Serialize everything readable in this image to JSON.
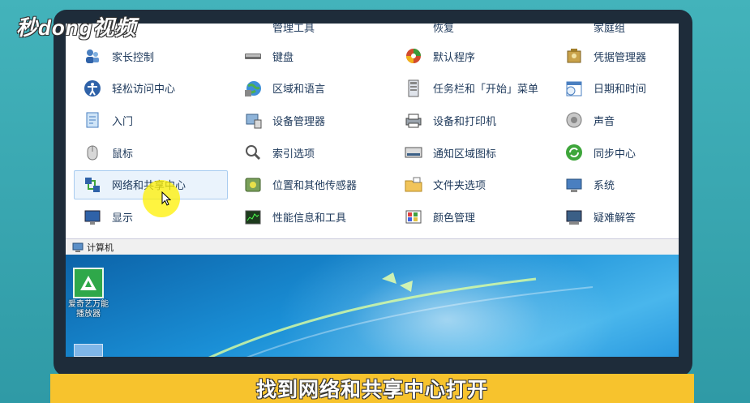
{
  "watermark": "秒dong视频",
  "control_panel": {
    "partial_top_row": [
      "…",
      "管理工具",
      "恢复",
      "家庭组"
    ],
    "items": [
      {
        "label": "家长控制",
        "icon": "parental-controls-icon"
      },
      {
        "label": "键盘",
        "icon": "keyboard-icon"
      },
      {
        "label": "默认程序",
        "icon": "default-programs-icon"
      },
      {
        "label": "凭据管理器",
        "icon": "credential-manager-icon"
      },
      {
        "label": "轻松访问中心",
        "icon": "ease-of-access-icon"
      },
      {
        "label": "区域和语言",
        "icon": "region-language-icon"
      },
      {
        "label": "任务栏和「开始」菜单",
        "icon": "taskbar-start-menu-icon"
      },
      {
        "label": "日期和时间",
        "icon": "date-time-icon"
      },
      {
        "label": "入门",
        "icon": "getting-started-icon"
      },
      {
        "label": "设备管理器",
        "icon": "device-manager-icon"
      },
      {
        "label": "设备和打印机",
        "icon": "devices-printers-icon"
      },
      {
        "label": "声音",
        "icon": "sound-icon"
      },
      {
        "label": "鼠标",
        "icon": "mouse-icon"
      },
      {
        "label": "索引选项",
        "icon": "indexing-options-icon"
      },
      {
        "label": "通知区域图标",
        "icon": "notification-area-icon"
      },
      {
        "label": "同步中心",
        "icon": "sync-center-icon"
      },
      {
        "label": "网络和共享中心",
        "icon": "network-sharing-icon"
      },
      {
        "label": "位置和其他传感器",
        "icon": "location-sensors-icon"
      },
      {
        "label": "文件夹选项",
        "icon": "folder-options-icon"
      },
      {
        "label": "系统",
        "icon": "system-icon"
      },
      {
        "label": "显示",
        "icon": "display-icon"
      },
      {
        "label": "性能信息和工具",
        "icon": "performance-icon"
      },
      {
        "label": "颜色管理",
        "icon": "color-management-icon"
      },
      {
        "label": "疑难解答",
        "icon": "troubleshooting-icon"
      }
    ],
    "status_bar": "计算机"
  },
  "desktop": {
    "icon_label": "爱奇艺万能播放器"
  },
  "subtitle": "找到网络和共享中心打开",
  "colors": {
    "frame": "#3aa6b0",
    "subtitle_bg": "#f7c32d",
    "label": "#1e395b",
    "selection": "#eaf3fc"
  }
}
